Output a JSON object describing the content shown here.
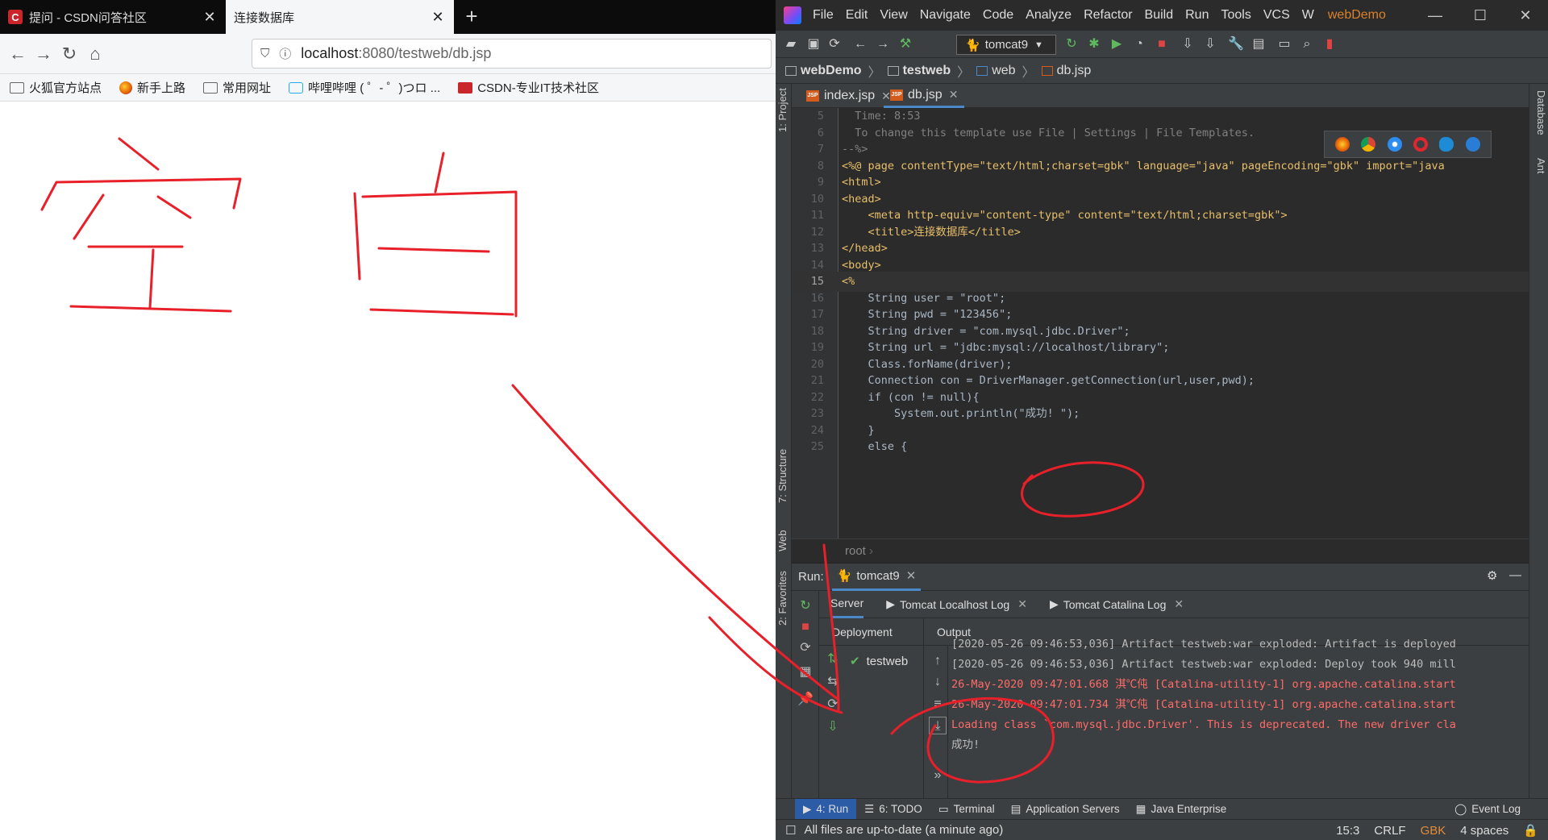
{
  "browser": {
    "tabs": [
      {
        "label": "提问 - CSDN问答社区",
        "favicon": "C",
        "active": false
      },
      {
        "label": "连接数据库",
        "active": true
      }
    ],
    "url_host": "localhost",
    "url_path": ":8080/testweb/db.jsp",
    "bookmarks": [
      "火狐官方站点",
      "新手上路",
      "常用网址",
      "哔哩哔哩 ( ゜- ゜)つロ ...",
      "CSDN-专业IT技术社区"
    ]
  },
  "annotation": {
    "handwritten_text": "空 白",
    "color": "#e8202a"
  },
  "ide": {
    "menu": [
      "File",
      "Edit",
      "View",
      "Navigate",
      "Code",
      "Analyze",
      "Refactor",
      "Build",
      "Run",
      "Tools",
      "VCS",
      "W"
    ],
    "project_name": "webDemo",
    "run_config": "tomcat9",
    "breadcrumbs": [
      "webDemo",
      "testweb",
      "web",
      "db.jsp"
    ],
    "editor_tabs": [
      "index.jsp",
      "db.jsp"
    ],
    "side_left": [
      "1: Project",
      "7: Structure",
      "Web",
      "2: Favorites"
    ],
    "side_right": [
      "Database",
      "Ant"
    ],
    "code": [
      {
        "n": "5",
        "t": "  Time: 8:53"
      },
      {
        "n": "6",
        "t": "  To change this template use File | Settings | File Templates."
      },
      {
        "n": "7",
        "t": "--%>"
      },
      {
        "n": "8",
        "t": "<%@ page contentType=\"text/html;charset=gbk\" language=\"java\" pageEncoding=\"gbk\" import=\"java"
      },
      {
        "n": "9",
        "t": "<html>"
      },
      {
        "n": "10",
        "t": "<head>"
      },
      {
        "n": "11",
        "t": "    <meta http-equiv=\"content-type\" content=\"text/html;charset=gbk\">"
      },
      {
        "n": "12",
        "t": "    <title>连接数据库</title>"
      },
      {
        "n": "13",
        "t": "</head>"
      },
      {
        "n": "14",
        "t": "<body>"
      },
      {
        "n": "15",
        "t": "<%"
      },
      {
        "n": "16",
        "t": "    String user = \"root\";"
      },
      {
        "n": "17",
        "t": "    String pwd = \"123456\";"
      },
      {
        "n": "18",
        "t": "    String driver = \"com.mysql.jdbc.Driver\";"
      },
      {
        "n": "19",
        "t": "    String url = \"jdbc:mysql://localhost/library\";"
      },
      {
        "n": "20",
        "t": "    Class.forName(driver);"
      },
      {
        "n": "21",
        "t": "    Connection con = DriverManager.getConnection(url,user,pwd);"
      },
      {
        "n": "22",
        "t": "    if (con != null){"
      },
      {
        "n": "23",
        "t": "        System.out.println(\"成功! \");"
      },
      {
        "n": "24",
        "t": "    }"
      },
      {
        "n": "25",
        "t": "    else {"
      }
    ],
    "editor_footer": "root",
    "run": {
      "label": "Run:",
      "tab": "tomcat9",
      "subtabs": [
        "Server",
        "Tomcat Localhost Log",
        "Tomcat Catalina Log"
      ],
      "deployment_header": "Deployment",
      "deployment_item": "testweb",
      "output_header": "Output",
      "output": [
        {
          "text": "[2020-05-26 09:46:53,036] Artifact testweb:war exploded: Artifact is deployed",
          "kind": "gray"
        },
        {
          "text": "[2020-05-26 09:46:53,036] Artifact testweb:war exploded: Deploy took 940 mill",
          "kind": "gray"
        },
        {
          "text": "26-May-2020 09:47:01.668 淇℃伅 [Catalina-utility-1] org.apache.catalina.start",
          "kind": "red"
        },
        {
          "text": "26-May-2020 09:47:01.734 淇℃伅 [Catalina-utility-1] org.apache.catalina.start",
          "kind": "red"
        },
        {
          "text": "Loading class `com.mysql.jdbc.Driver'. This is deprecated. The new driver cla",
          "kind": "red"
        },
        {
          "text": "成功!",
          "kind": "gray"
        }
      ]
    },
    "bottom_tabs": [
      "4: Run",
      "6: TODO",
      "Terminal",
      "Application Servers",
      "Java Enterprise"
    ],
    "event_log": "Event Log",
    "status": {
      "message": "All files are up-to-date (a minute ago)",
      "position": "15:3",
      "line_sep": "CRLF",
      "encoding": "GBK",
      "indent": "4 spaces"
    }
  }
}
